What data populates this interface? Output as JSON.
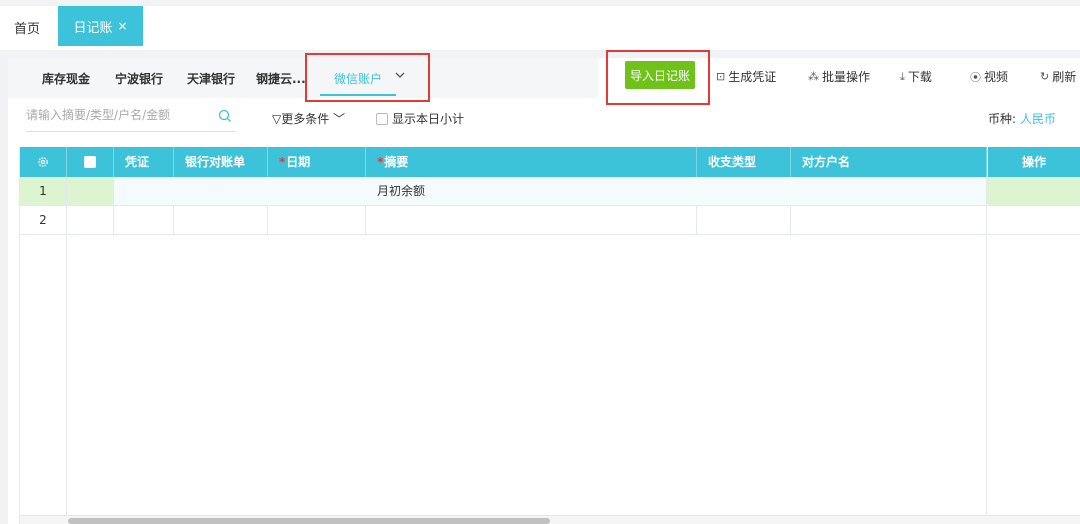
{
  "top_tabs": {
    "home": "首页",
    "active": "日记账",
    "close": "×"
  },
  "account_tabs": [
    "库存现金",
    "宁波银行",
    "天津银行",
    "钢捷云...",
    "微信账户"
  ],
  "toolbar": {
    "import": "导入日记账",
    "gen_voucher": "生成凭证",
    "batch": "批量操作",
    "download": "下载",
    "video": "视频",
    "refresh": "刷新"
  },
  "search": {
    "placeholder": "请输入摘要/类型/户名/金额"
  },
  "filters": {
    "more": "更多条件",
    "show_daily": "显示本日小计",
    "currency_label": "币种:",
    "currency_value": "人民币"
  },
  "table": {
    "headers": {
      "voucher": "凭证",
      "bank_stmt": "银行对账单",
      "date": "日期",
      "summary": "摘要",
      "type": "收支类型",
      "counterparty": "对方户名",
      "ops": "操作"
    },
    "rows": [
      {
        "index": "1",
        "summary": "月初余额"
      },
      {
        "index": "2",
        "summary": ""
      }
    ]
  },
  "colors": {
    "accent": "#3dc3d9",
    "import_button": "#6ec21a",
    "highlight_box": "#e53935",
    "required_mark": "#e53935"
  }
}
